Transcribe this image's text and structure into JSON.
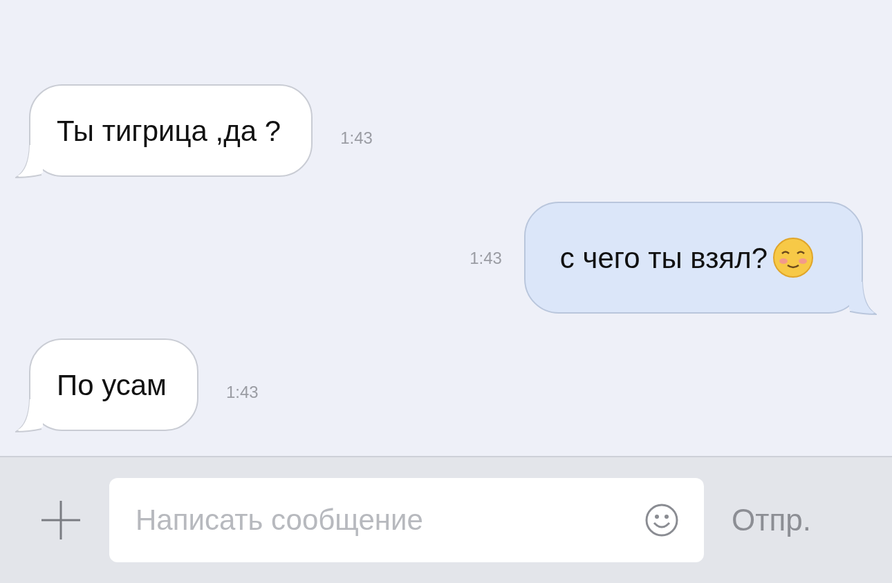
{
  "messages": [
    {
      "kind": "incoming",
      "text": "Ты тигрица ,да ?",
      "time": "1:43",
      "emoji": false
    },
    {
      "kind": "outgoing",
      "text": "с чего ты взял?",
      "time": "1:43",
      "emoji": true
    },
    {
      "kind": "incoming",
      "text": "По усам",
      "time": "1:43",
      "emoji": false
    }
  ],
  "composer": {
    "placeholder": "Написать сообщение",
    "send": "Отпр."
  }
}
